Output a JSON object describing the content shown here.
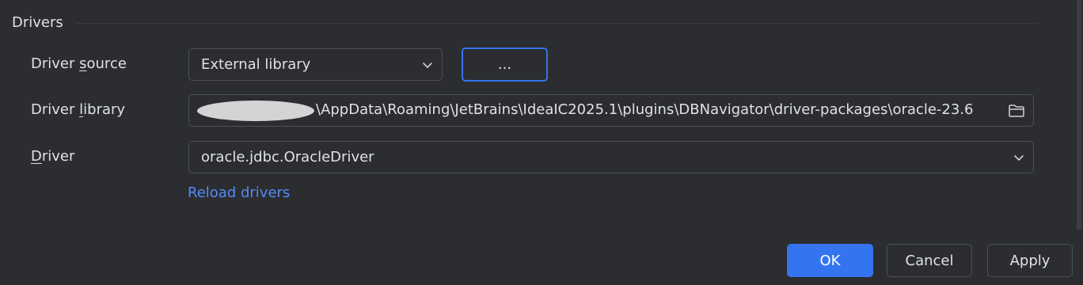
{
  "section": {
    "title": "Drivers"
  },
  "driver_source": {
    "label_prefix": "Driver ",
    "label_mnemonic": "s",
    "label_suffix": "ource",
    "value": "External library",
    "browse_label": "..."
  },
  "driver_library": {
    "label_prefix": "Driver ",
    "label_mnemonic": "l",
    "label_suffix": "ibrary",
    "path": "\\AppData\\Roaming\\JetBrains\\IdeaIC2025.1\\plugins\\DBNavigator\\driver-packages\\oracle-23.6"
  },
  "driver": {
    "label_mnemonic": "D",
    "label_suffix": "river",
    "value": "oracle.jdbc.OracleDriver",
    "reload_label": "Reload drivers"
  },
  "footer": {
    "ok_label": "OK",
    "cancel_label": "Cancel",
    "apply_label": "Apply"
  },
  "icons": {
    "combo_arrow": "chevron-down-icon",
    "library_browse": "folder-icon"
  },
  "colors": {
    "accent": "#3574f0",
    "link": "#548af7",
    "background": "#2b2d30"
  }
}
